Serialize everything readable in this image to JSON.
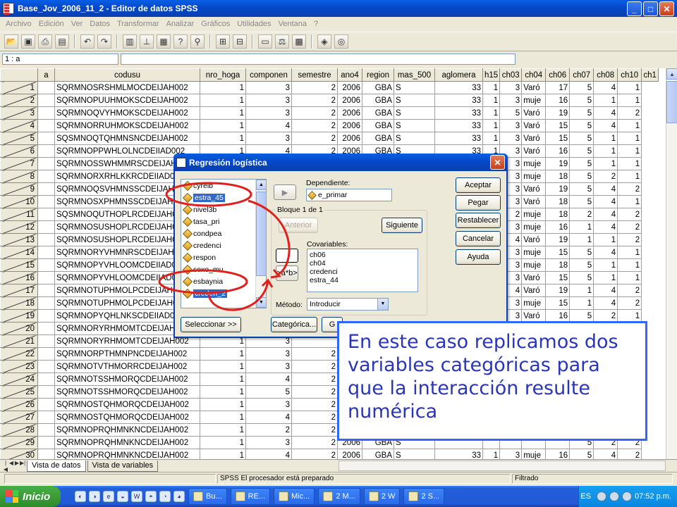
{
  "window": {
    "title": "Base_Jov_2006_11_2 - Editor de datos SPSS",
    "min": "_",
    "max": "□",
    "close": "✕"
  },
  "menu": [
    "Archivo",
    "Edición",
    "Ver",
    "Datos",
    "Transformar",
    "Analizar",
    "Gráficos",
    "Utilidades",
    "Ventana",
    "?"
  ],
  "cell_ref": "1 : a",
  "grid": {
    "columns": [
      "a",
      "codusu",
      "nro_hoga",
      "componen",
      "semestre",
      "ano4",
      "region",
      "mas_500",
      "aglomera",
      "h15",
      "ch03",
      "ch04",
      "ch06",
      "ch07",
      "ch08",
      "ch10",
      "ch1"
    ],
    "rows": [
      [
        "1",
        "",
        "SQRMNOSRSHMLMOCDEIJAH002",
        "1",
        "3",
        "2",
        "2006",
        "GBA",
        "S",
        "33",
        "1",
        "3",
        "Varó",
        "17",
        "5",
        "4",
        "1"
      ],
      [
        "2",
        "",
        "SQRMNOPUUHMOKSCDEIJAH002",
        "1",
        "3",
        "2",
        "2006",
        "GBA",
        "S",
        "33",
        "1",
        "3",
        "muje",
        "16",
        "5",
        "1",
        "1"
      ],
      [
        "3",
        "",
        "SQRMNOQVYHMOKSCDEIJAH002",
        "1",
        "3",
        "2",
        "2006",
        "GBA",
        "S",
        "33",
        "1",
        "5",
        "Varó",
        "19",
        "5",
        "4",
        "2"
      ],
      [
        "4",
        "",
        "SQRMNORRUHMOKSCDEIJAH002",
        "1",
        "4",
        "2",
        "2006",
        "GBA",
        "S",
        "33",
        "1",
        "3",
        "Varó",
        "15",
        "5",
        "4",
        "1"
      ],
      [
        "5",
        "",
        "SQSMNOQTQHMNSNCDEIJAH002",
        "1",
        "3",
        "2",
        "2006",
        "GBA",
        "S",
        "33",
        "1",
        "3",
        "Varó",
        "15",
        "5",
        "1",
        "1"
      ],
      [
        "6",
        "",
        "SQRMNOPPWHLOLNCDEIIAD002",
        "1",
        "4",
        "2",
        "2006",
        "GBA",
        "S",
        "33",
        "1",
        "3",
        "Varó",
        "16",
        "5",
        "1",
        "1"
      ],
      [
        "7",
        "",
        "SQRMNOSSWHMMRSCDEIJAH002",
        "",
        "",
        "",
        "",
        "",
        "",
        "",
        "",
        "3",
        "muje",
        "19",
        "5",
        "1",
        "1"
      ],
      [
        "8",
        "",
        "SQRMNORXRHLKKRCDEIIAD002",
        "",
        "",
        "",
        "",
        "",
        "",
        "",
        "",
        "3",
        "muje",
        "18",
        "5",
        "2",
        "1"
      ],
      [
        "9",
        "",
        "SQRMNOQSVHMNSSCDEIJAH002",
        "",
        "",
        "",
        "",
        "",
        "",
        "",
        "",
        "3",
        "Varó",
        "19",
        "5",
        "4",
        "2"
      ],
      [
        "10",
        "",
        "SQRMNOSXPHMNSSCDEIJAH002",
        "",
        "",
        "",
        "",
        "",
        "",
        "",
        "",
        "3",
        "Varó",
        "18",
        "5",
        "4",
        "1"
      ],
      [
        "11",
        "",
        "SQSMNOQUTHOPLRCDEIJAH002",
        "",
        "",
        "",
        "",
        "",
        "",
        "",
        "",
        "2",
        "muje",
        "18",
        "2",
        "4",
        "2"
      ],
      [
        "12",
        "",
        "SQRMNOSUSHOPLRCDEIJAH002",
        "",
        "",
        "",
        "",
        "",
        "",
        "",
        "",
        "3",
        "muje",
        "16",
        "1",
        "4",
        "2"
      ],
      [
        "13",
        "",
        "SQRMNOSUSHOPLRCDEIJAH002",
        "",
        "",
        "",
        "",
        "",
        "",
        "",
        "",
        "4",
        "Varó",
        "19",
        "1",
        "1",
        "2"
      ],
      [
        "14",
        "",
        "SQRMNORYVHMNRSCDEIJAH002",
        "",
        "",
        "",
        "",
        "",
        "",
        "",
        "",
        "3",
        "muje",
        "15",
        "5",
        "4",
        "1"
      ],
      [
        "15",
        "",
        "SQRMNOPYVHLOOMCDEIIAD002",
        "",
        "",
        "",
        "",
        "",
        "",
        "",
        "",
        "3",
        "muje",
        "18",
        "5",
        "1",
        "1"
      ],
      [
        "16",
        "",
        "SQRMNOPYVHLOOMCDEIIAD002",
        "",
        "",
        "",
        "",
        "",
        "",
        "",
        "",
        "3",
        "Varó",
        "15",
        "5",
        "1",
        "1"
      ],
      [
        "17",
        "",
        "SQRMNOTUPHMOLPCDEIJAH002",
        "",
        "",
        "",
        "",
        "",
        "",
        "",
        "",
        "4",
        "Varó",
        "19",
        "1",
        "4",
        "2"
      ],
      [
        "18",
        "",
        "SQRMNOTUPHMOLPCDEIJAH002",
        "",
        "",
        "",
        "",
        "",
        "",
        "",
        "",
        "3",
        "muje",
        "15",
        "1",
        "4",
        "2"
      ],
      [
        "19",
        "",
        "SQRMNOPYQHLNKSCDEIIAD002",
        "",
        "",
        "",
        "",
        "",
        "",
        "",
        "",
        "3",
        "Varó",
        "16",
        "5",
        "2",
        "1"
      ],
      [
        "20",
        "",
        "SQRMNORYRHMOMTCDEIJAH002",
        "",
        "",
        "",
        "",
        "",
        "",
        "",
        "",
        "",
        "",
        "",
        "",
        "",
        ""
      ],
      [
        "21",
        "",
        "SQRMNORYRHMOMTCDEIJAH002",
        "1",
        "3",
        "",
        "",
        "",
        "",
        "",
        "",
        "",
        "",
        "",
        "",
        "",
        ""
      ],
      [
        "22",
        "",
        "SQRMNORPTHMNPNCDEIJAH002",
        "1",
        "3",
        "2",
        "",
        "",
        "",
        "",
        "",
        "",
        "",
        "",
        "",
        "",
        ""
      ],
      [
        "23",
        "",
        "SQRMNOTVTHMORRCDEIJAH002",
        "1",
        "3",
        "2",
        "",
        "",
        "",
        "",
        "",
        "",
        "",
        "",
        "",
        "",
        ""
      ],
      [
        "24",
        "",
        "SQRMNOTSSHMORQCDEIJAH002",
        "1",
        "4",
        "2",
        "",
        "",
        "",
        "",
        "",
        "",
        "",
        "",
        "",
        "",
        ""
      ],
      [
        "25",
        "",
        "SQRMNOTSSHMORQCDEIJAH002",
        "1",
        "5",
        "2",
        "",
        "",
        "",
        "",
        "",
        "",
        "",
        "",
        "",
        "",
        ""
      ],
      [
        "26",
        "",
        "SQRMNOSTQHMORQCDEIJAH002",
        "1",
        "3",
        "2",
        "",
        "",
        "",
        "",
        "",
        "",
        "",
        "",
        "",
        "",
        ""
      ],
      [
        "27",
        "",
        "SQRMNOSTQHMORQCDEIJAH002",
        "1",
        "4",
        "2",
        "",
        "",
        "",
        "",
        "",
        "",
        "",
        "",
        "",
        "",
        ""
      ],
      [
        "28",
        "",
        "SQRMNOPRQHMNKNCDEIJAH002",
        "1",
        "2",
        "2",
        "",
        "",
        "",
        "",
        "",
        "",
        "",
        "",
        "",
        "",
        ""
      ],
      [
        "29",
        "",
        "SQRMNOPRQHMNKNCDEIJAH002",
        "1",
        "3",
        "2",
        "2006",
        "GBA",
        "S",
        "",
        "",
        "",
        "",
        "",
        "5",
        "2",
        "2"
      ],
      [
        "30",
        "",
        "SQRMNOPRQHMNKNCDEIJAH002",
        "1",
        "4",
        "2",
        "2006",
        "GBA",
        "S",
        "33",
        "1",
        "3",
        "muje",
        "16",
        "5",
        "4",
        "2"
      ]
    ]
  },
  "sheet_tabs": [
    "Vista de datos",
    "Vista de variables"
  ],
  "status": {
    "processor": "SPSS El procesador  está preparado",
    "filter": "Filtrado"
  },
  "taskbar": {
    "start": "Inicio",
    "tasks": [
      "Bu...",
      "RE...",
      "Mic...",
      "2 M...",
      "2 W",
      "2 S...",
      "ES"
    ],
    "clock": "07:52 p.m."
  },
  "dialog": {
    "title": "Regresión logística",
    "close": "✕",
    "variables": [
      {
        "name": "cyrelb",
        "selected": false
      },
      {
        "name": "estra_45",
        "selected": true
      },
      {
        "name": "nivel3b",
        "selected": false
      },
      {
        "name": "tasa_pri",
        "selected": false
      },
      {
        "name": "condpea",
        "selected": false
      },
      {
        "name": "credenci",
        "selected": false
      },
      {
        "name": "respon",
        "selected": false
      },
      {
        "name": "sexo_mu",
        "selected": false
      },
      {
        "name": "esbaynia",
        "selected": false
      },
      {
        "name": "creden_2",
        "selected": true
      }
    ],
    "dependiente_label": "Dependiente:",
    "dependiente_value": "e_primar",
    "bloque_label": "Bloque 1 de 1",
    "anterior": "Anterior",
    "siguiente": "Siguiente",
    "covariables_label": "Covariables:",
    "covariables": [
      "ch06",
      "ch04",
      "credenci",
      "estra_44"
    ],
    "interaction_button": ">a*b>",
    "metodo_label": "Método:",
    "metodo_value": "Introducir",
    "seleccionar": "Seleccionar >>",
    "categorica": "Categórica...",
    "guardar_partial": "G",
    "buttons": [
      "Aceptar",
      "Pegar",
      "Restablecer",
      "Cancelar",
      "Ayuda"
    ]
  },
  "callout": {
    "text": "En este caso replicamos dos variables categóricas para que la interacción resulte numérica"
  },
  "colors": {
    "annotation_red": "#e0201c",
    "callout_text": "#2a35b8",
    "callout_border": "#3366ff",
    "selection_blue": "#316ac5"
  }
}
